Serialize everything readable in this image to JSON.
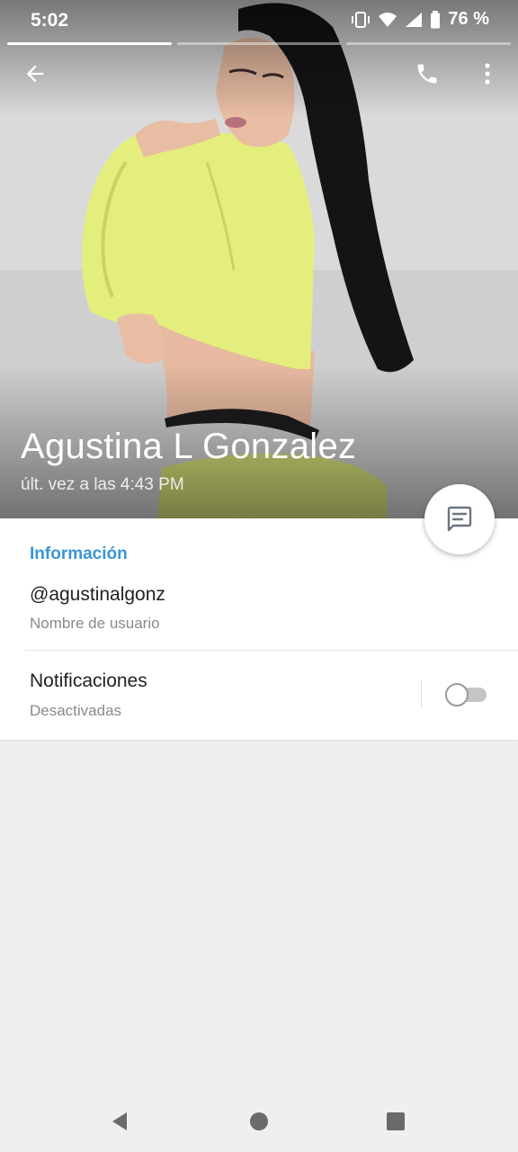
{
  "status_bar": {
    "time": "5:02",
    "battery": "76 %",
    "icons": [
      "vibrate-icon",
      "wifi-icon",
      "signal-icon",
      "battery-icon"
    ]
  },
  "story_bars": {
    "count": 3,
    "active_index": 0
  },
  "toolbar": {
    "icons": [
      "back-arrow-icon",
      "phone-icon",
      "more-vert-icon"
    ]
  },
  "profile": {
    "name": "Agustina L Gonzalez",
    "last_seen": "últ. vez a las 4:43 PM"
  },
  "fab": {
    "icon": "message-icon"
  },
  "info": {
    "section_title": "Información",
    "username": {
      "value": "@agustinalgonz",
      "label": "Nombre de usuario"
    },
    "notifications": {
      "title": "Notificaciones",
      "status": "Desactivadas",
      "enabled": false
    }
  },
  "nav": {
    "icons": [
      "back-triangle-icon",
      "home-circle-icon",
      "recents-square-icon"
    ]
  },
  "colors": {
    "accent": "#3a95d5",
    "background": "#efefef",
    "card": "#ffffff"
  }
}
